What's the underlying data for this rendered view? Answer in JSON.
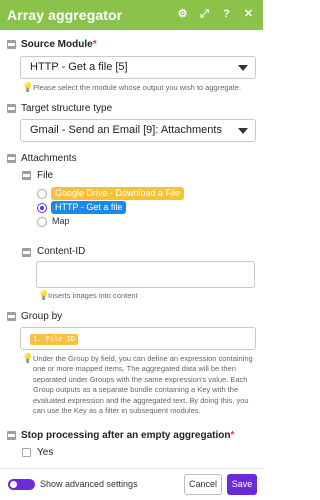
{
  "header": {
    "title": "Array aggregator",
    "icons": [
      "settings-icon",
      "expand-icon",
      "help-icon",
      "close-icon"
    ]
  },
  "source_module": {
    "label": "Source Module",
    "required_mark": "*",
    "value": "HTTP - Get a file [5]",
    "hint": "Please select the module whose output you wish to aggregate."
  },
  "target_structure": {
    "label": "Target structure type",
    "value": "Gmail - Send an Email [9]: Attachments"
  },
  "attachments": {
    "label": "Attachments",
    "file": {
      "label": "File",
      "options": [
        {
          "label": "Google Drive - Download a File",
          "selected": false
        },
        {
          "label": "HTTP - Get a file",
          "selected": true
        },
        {
          "label": "Map",
          "selected": false
        }
      ]
    },
    "content_id": {
      "label": "Content-ID",
      "value": "",
      "hint": "Inserts images into content"
    }
  },
  "group_by": {
    "label": "Group by",
    "token": "1. File ID",
    "hint": "Under the Group by field, you can define an expression containing one or more mapped items. The aggregated data will be then separated under Groups with the same expression's value. Each Group outputs as a separate bundle containing a Key with the evaluated expression and the aggregated text. By doing this, you can use the Key as a filter in subsequent modules."
  },
  "stop_processing": {
    "label": "Stop processing after an empty aggregation",
    "required_mark": "*",
    "option_label": "Yes"
  },
  "footer": {
    "advanced_label": "Show advanced settings",
    "cancel_label": "Cancel",
    "save_label": "Save"
  },
  "colors": {
    "header_bg": "#8bc34a",
    "accent": "#6c2bd9",
    "token_bg": "#f7c23a",
    "http_pill_bg": "#1e88e5"
  }
}
